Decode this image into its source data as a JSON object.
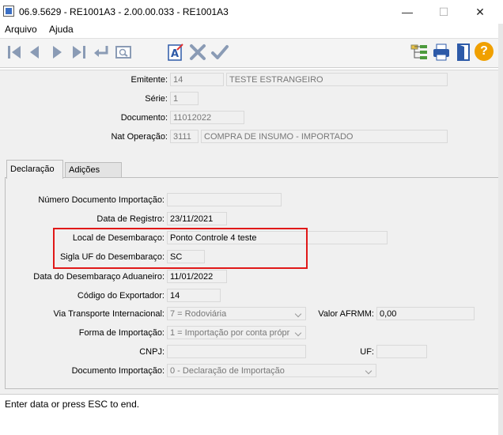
{
  "window": {
    "title": "06.9.5629 - RE1001A3 - 2.00.00.033 - RE1001A3",
    "minimize": "—",
    "maximize": "☐",
    "close": "✕"
  },
  "menu": {
    "items": [
      "Arquivo",
      "Ajuda"
    ]
  },
  "toolbar": {
    "icons": [
      "first-record-icon",
      "previous-record-icon",
      "next-record-icon",
      "last-record-icon",
      "go-to-icon",
      "search-icon",
      "edit-text-icon",
      "cancel-icon",
      "confirm-icon",
      "hierarchy-icon",
      "print-icon",
      "exit-icon",
      "help-icon"
    ],
    "help_glyph": "?"
  },
  "header": {
    "emitente": {
      "label": "Emitente:",
      "code": "14",
      "name": "TESTE ESTRANGEIRO"
    },
    "serie": {
      "label": "Série:",
      "value": "1"
    },
    "documento": {
      "label": "Documento:",
      "value": "11012022"
    },
    "nat_operacao": {
      "label": "Nat Operação:",
      "code": "3111",
      "name": "COMPRA DE INSUMO - IMPORTADO"
    }
  },
  "tabs": [
    {
      "label": "Declaração",
      "active": true
    },
    {
      "label": "Adições",
      "active": false
    }
  ],
  "form": {
    "numero_doc": {
      "label": "Número Documento Importação:",
      "value": ""
    },
    "data_registro": {
      "label": "Data de Registro:",
      "value": "23/11/2021"
    },
    "local_desembaraco": {
      "label": "Local de Desembaraço:",
      "value": "Ponto Controle 4 teste"
    },
    "sigla_uf": {
      "label": "Sigla UF do Desembaraço:",
      "value": "SC"
    },
    "data_desembaraco": {
      "label": "Data do Desembaraço Aduaneiro:",
      "value": "11/01/2022"
    },
    "codigo_exportador": {
      "label": "Código do Exportador:",
      "value": "14"
    },
    "via_transporte": {
      "label": "Via Transporte Internacional:",
      "value": "7 = Rodoviária"
    },
    "valor_afrmm": {
      "label": "Valor AFRMM:",
      "value": "0,00"
    },
    "forma_importacao": {
      "label": "Forma de Importação:",
      "value": "1 = Importação por conta própr"
    },
    "cnpj": {
      "label": "CNPJ:",
      "value": ""
    },
    "uf": {
      "label": "UF:",
      "value": ""
    },
    "documento_importacao": {
      "label": "Documento Importação:",
      "value": "0 - Declaração de Importação"
    }
  },
  "status": {
    "text": "Enter data or press ESC to end."
  },
  "colors": {
    "highlight": "#e01818",
    "accent": "#2d5aa8",
    "help": "#f0a000"
  }
}
